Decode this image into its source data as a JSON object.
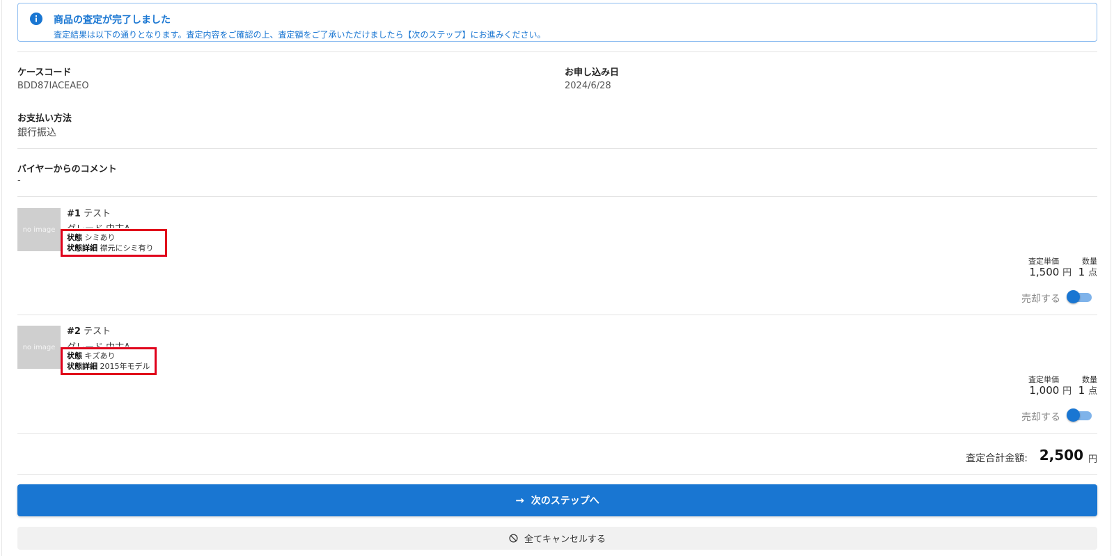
{
  "alert": {
    "title": "商品の査定が完了しました",
    "message": "査定結果は以下の通りとなります。査定内容をご確認の上、査定額をご了承いただけましたら【次のステップ】にお進みください。",
    "icon": "info-icon",
    "color": "#1976d2"
  },
  "case": {
    "code_label": "ケースコード",
    "code_value": "BDD87IACEAEO",
    "date_label": "お申し込み日",
    "date_value": "2024/6/28",
    "payment_label": "お支払い方法",
    "payment_value": "銀行振込",
    "comment_label": "バイヤーからのコメント",
    "comment_value": "-"
  },
  "items": [
    {
      "no": "#1",
      "name": "テスト",
      "image_text": "no image",
      "grade": "グレード 中古A",
      "condition_label": "状態",
      "condition_value": "シミあり",
      "condition_detail_label": "状態詳細",
      "condition_detail_value": "襟元にシミ有り",
      "unit_price_label": "査定単価",
      "quantity_label": "数量",
      "unit_price": "1,500",
      "price_unit": "円",
      "quantity": "1",
      "quantity_unit": "点",
      "sell_label": "売却する",
      "sell_on": true
    },
    {
      "no": "#2",
      "name": "テスト",
      "image_text": "no image",
      "grade": "グレード 中古A",
      "condition_label": "状態",
      "condition_value": "キズあり",
      "condition_detail_label": "状態詳細",
      "condition_detail_value": "2015年モデル",
      "unit_price_label": "査定単価",
      "quantity_label": "数量",
      "unit_price": "1,000",
      "price_unit": "円",
      "quantity": "1",
      "quantity_unit": "点",
      "sell_label": "売却する",
      "sell_on": true
    }
  ],
  "total": {
    "label": "査定合計金額:",
    "value": "2,500",
    "unit": "円"
  },
  "actions": {
    "next_label": "次のステップへ",
    "next_icon": "arrow-right-icon",
    "cancel_label": "全てキャンセルする",
    "cancel_icon": "ban-icon"
  },
  "colors": {
    "primary": "#1976d2",
    "highlight": "#e0001b"
  }
}
